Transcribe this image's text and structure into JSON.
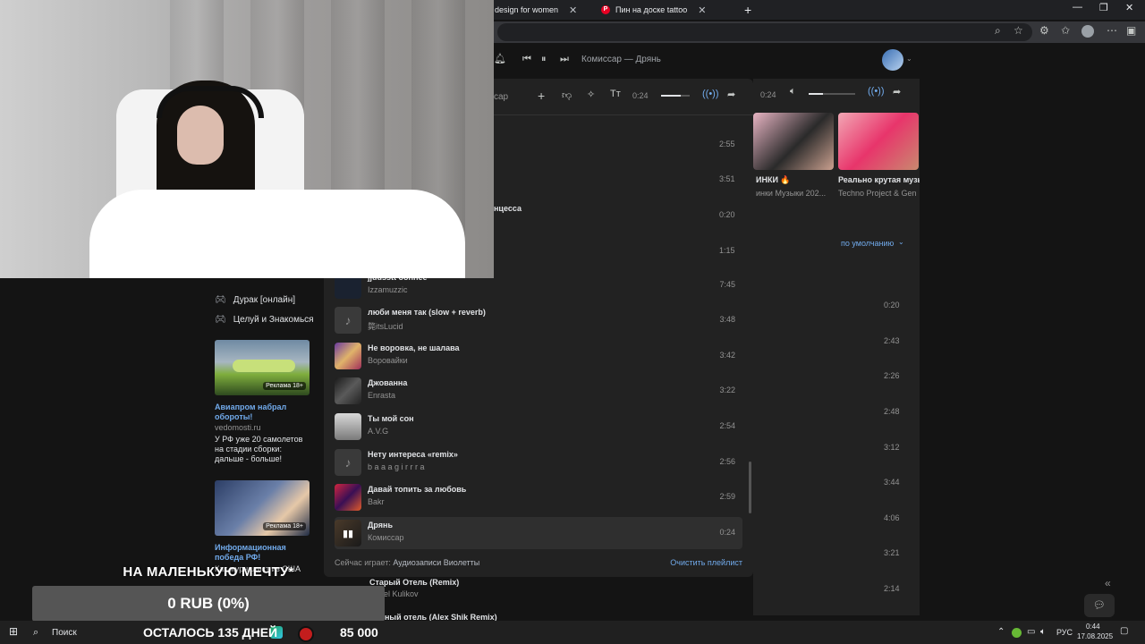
{
  "browser": {
    "tabs": [
      {
        "label": "design for women"
      },
      {
        "label": "Пин на доске tattoo"
      }
    ],
    "new_tab": "+",
    "window_controls": {
      "minimize": "—",
      "restore": "❐",
      "close": "✕"
    }
  },
  "player_header": {
    "now_playing": "Комиссар — Дрянь"
  },
  "popup": {
    "search_fragment": "сар",
    "time": "0:24",
    "top_durations": [
      "2:55",
      "3:51",
      "0:20",
      "1:15"
    ],
    "partial_title": "нцесса",
    "tracks": [
      {
        "title": "jjuusstt oonnee",
        "artist": "Izzamuzzic",
        "duration": "7:45",
        "cover": "dark"
      },
      {
        "title": "люби меня так (slow + reverb)",
        "artist": "斃itsLucid",
        "duration": "3:48",
        "cover": "note"
      },
      {
        "title": "Не воровка, не шалава",
        "artist": "Воровайки",
        "duration": "3:42",
        "cover": "art1"
      },
      {
        "title": "Джованна",
        "artist": "Enrasta",
        "duration": "3:22",
        "cover": "art2"
      },
      {
        "title": "Ты мой сон",
        "artist": "A.V.G",
        "duration": "2:54",
        "cover": "art3"
      },
      {
        "title": "Нету интереса «remix»",
        "artist": "b a a a g i r r r a",
        "duration": "2:56",
        "cover": "note"
      },
      {
        "title": "Давай топить за любовь",
        "artist": "Bakr",
        "duration": "2:59",
        "cover": "art4"
      },
      {
        "title": "Дрянь",
        "artist": "Комиссар",
        "duration": "0:24",
        "cover": "playing",
        "active": true
      }
    ],
    "footer_label": "Сейчас играет:",
    "footer_playlist": "Аудиозаписи Виолетты",
    "clear_label": "Очистить плейлист"
  },
  "below_popup": [
    {
      "title": "Старый Отель (Remix)",
      "artist": "ael Kulikov"
    },
    {
      "title": "ный отель (Alex Shik Remix)"
    }
  ],
  "right_panel": {
    "time": "0:24",
    "playlists": [
      {
        "title": "ИНКИ 🔥",
        "subtitle": "инки Музыки 202..."
      },
      {
        "title": "Реально крутая музы",
        "subtitle": "Techno Project & Gen"
      }
    ],
    "sort_label": "по умолчанию",
    "durations": [
      "0:20",
      "2:43",
      "2:26",
      "2:48",
      "3:12",
      "3:44",
      "4:06",
      "3:21",
      "2:14"
    ]
  },
  "sidebar": {
    "items": [
      {
        "label": "Дурак [онлайн]"
      },
      {
        "label": "Целуй и Знакомься"
      }
    ]
  },
  "ads": [
    {
      "badge": "Реклама 18+",
      "title": "Авиапром набрал обороты!",
      "source": "vedomosti.ru",
      "text": "У РФ уже 20 самолетов на стадии сборки: дальше - больше!"
    },
    {
      "badge": "Реклама 18+",
      "title": "Информационная победа РФ!",
      "source": "",
      "text": "Как журналист из США"
    }
  ],
  "donation": {
    "goal_title": "НА МАЛЕНЬКУЮ МЕЧТУ*",
    "amount": "0 RUB (0%)",
    "days_left": "ОСТАЛОСЬ 135 ДНЕЙ",
    "goal_amount": "85 000"
  },
  "taskbar": {
    "search": "Поиск",
    "lang": "РУС",
    "time": "0:44",
    "date": "17.08.2025"
  },
  "colors": {
    "accent": "#71aaeb",
    "bg": "#141414",
    "panel": "#222222"
  }
}
